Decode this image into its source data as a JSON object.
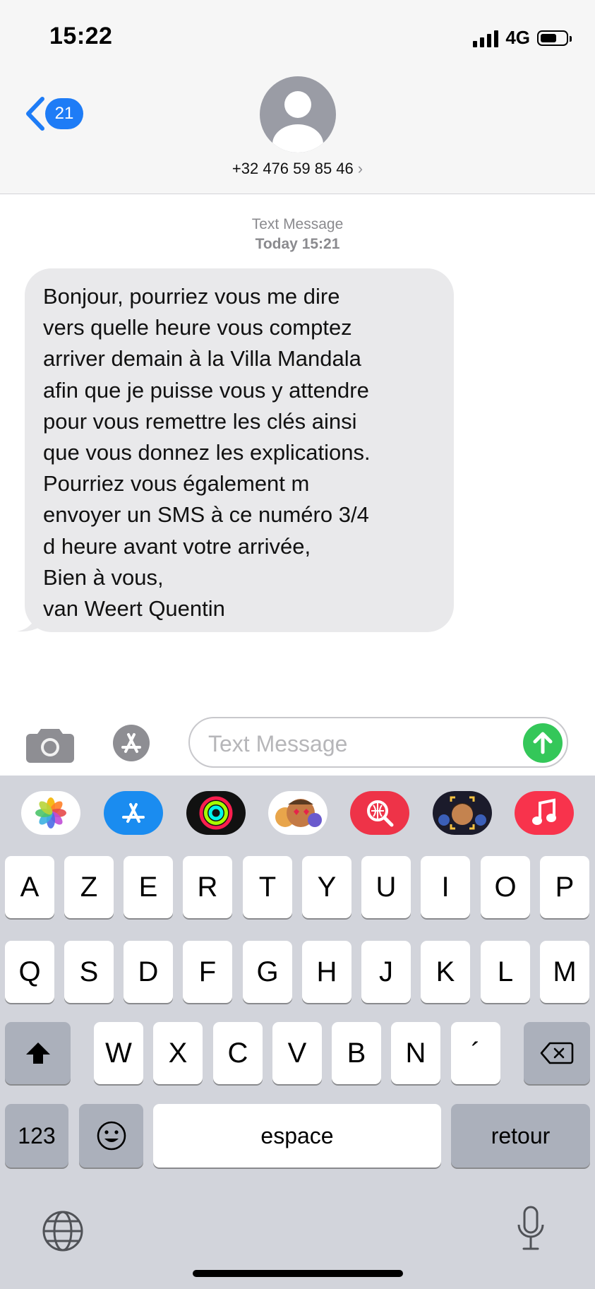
{
  "status_bar": {
    "time": "15:22",
    "network": "4G",
    "battery_level": 0.6
  },
  "nav": {
    "unread_count": "21",
    "contact_number": "+32 476 59 85 46",
    "contact_chevron": "›"
  },
  "conversation": {
    "service_label": "Text Message",
    "timestamp": "Today 15:21",
    "messages": [
      {
        "direction": "incoming",
        "text": "Bonjour, pourriez vous me dire\nvers quelle heure vous comptez\narriver demain à la Villa Mandala\nafin que je puisse vous y attendre\npour vous remettre les clés ainsi\nque vous donnez les explications.\nPourriez vous également m\nenvoyer un SMS à ce numéro 3/4\nd heure avant votre arrivée,\nBien à vous,\nvan Weert Quentin"
      }
    ]
  },
  "composer": {
    "placeholder": "Text Message"
  },
  "app_strip": [
    "photos-app",
    "app-store-app",
    "activity-app",
    "memoji-stickers-app",
    "web-search-app",
    "memoji-app",
    "music-app"
  ],
  "keyboard": {
    "row1": [
      "A",
      "Z",
      "E",
      "R",
      "T",
      "Y",
      "U",
      "I",
      "O",
      "P"
    ],
    "row2": [
      "Q",
      "S",
      "D",
      "F",
      "G",
      "H",
      "J",
      "K",
      "L",
      "M"
    ],
    "row3": [
      "W",
      "X",
      "C",
      "V",
      "B",
      "N",
      "´"
    ],
    "numbers_label": "123",
    "space_label": "espace",
    "return_label": "retour"
  },
  "colors": {
    "accent": "#1e7cf6",
    "send": "#34c759",
    "bubble": "#e9e9eb",
    "keyboard_bg": "#d2d4db"
  }
}
